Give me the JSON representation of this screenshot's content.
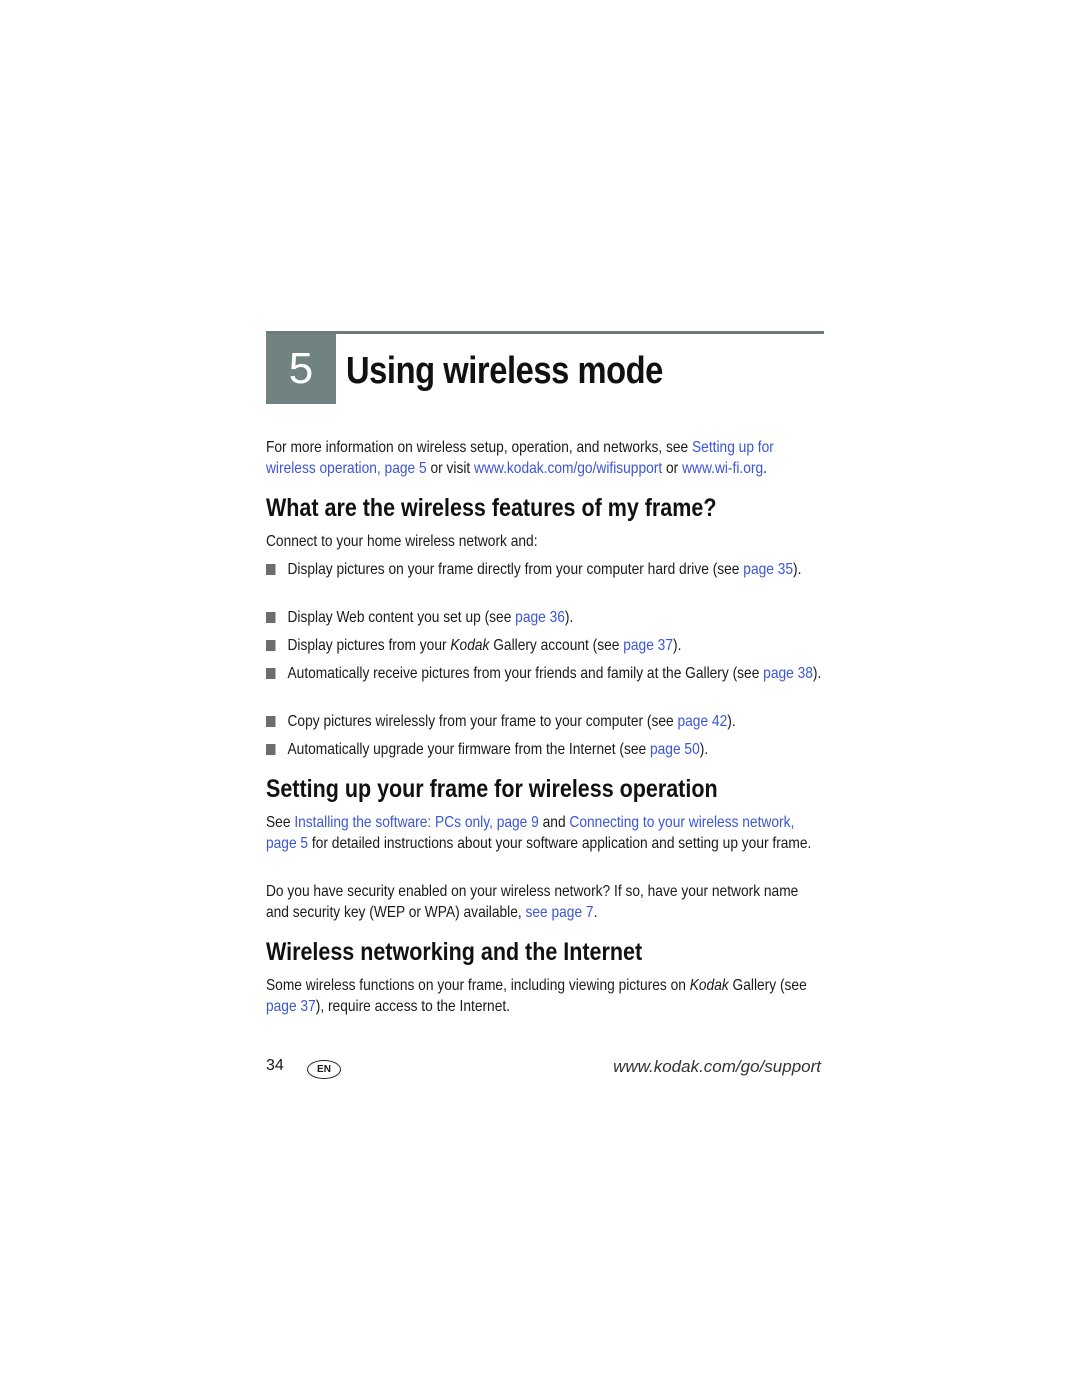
{
  "chapter": {
    "number": "5",
    "title": "Using wireless mode"
  },
  "intro": {
    "t1": "For more information on wireless setup, operation, and networks, see ",
    "link1": "Setting up for wireless operation, page 5",
    "t2": " or visit ",
    "link2": "www.kodak.com/go/wifisupport",
    "t3": " or ",
    "link3": "www.wi-fi.org",
    "t4": "."
  },
  "section1": {
    "heading": "What are the wireless features of my frame?",
    "lead": "Connect to your home wireless network and:",
    "bullets": [
      {
        "pre": "Display pictures on your frame directly from your computer hard drive (see ",
        "italic": "",
        "mid": "",
        "link": "page 35",
        "post": ")."
      },
      {
        "pre": "Display Web content you set up (see ",
        "italic": "",
        "mid": "",
        "link": "page 36",
        "post": ")."
      },
      {
        "pre": "Display pictures from your ",
        "italic": "Kodak",
        "mid": " Gallery account (see ",
        "link": "page 37",
        "post": ")."
      },
      {
        "pre": "Automatically receive pictures from your friends and family at the Gallery (see ",
        "italic": "",
        "mid": "",
        "link": "page 38",
        "post": ")."
      },
      {
        "pre": "Copy pictures wirelessly from your frame to your computer (see ",
        "italic": "",
        "mid": "",
        "link": "page 42",
        "post": ")."
      },
      {
        "pre": "Automatically upgrade your firmware from the Internet (see ",
        "italic": "",
        "mid": "",
        "link": "page 50",
        "post": ")."
      }
    ]
  },
  "section2": {
    "heading": "Setting up your frame for wireless operation",
    "p1": {
      "t1": "See ",
      "link1": "Installing the software: PCs only, page 9",
      "t2": " and ",
      "link2": "Connecting to your wireless network, page 5",
      "t3": " for detailed instructions about your software application and setting up your frame."
    },
    "p2": {
      "t1": "Do you have security enabled on your wireless network? If so, have your network name and security key (WEP or WPA) available, ",
      "link1": "see page 7",
      "t2": "."
    }
  },
  "section3": {
    "heading": "Wireless networking and the Internet",
    "p1": {
      "t1": "Some wireless functions on your frame, including viewing pictures on ",
      "italic": "Kodak",
      "t2": " Gallery (see ",
      "link1": "page 37",
      "t3": "), require access to the Internet."
    }
  },
  "footer": {
    "page_number": "34",
    "language_badge": "EN",
    "url": "www.kodak.com/go/support"
  }
}
